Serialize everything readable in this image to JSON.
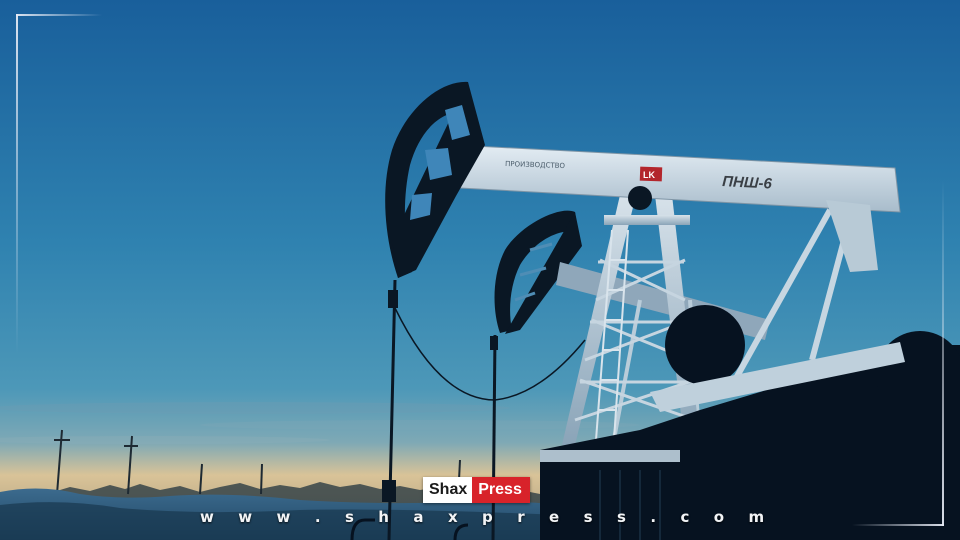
{
  "photo": {
    "sky_top_color": "#1c6aa8",
    "sky_mid_color": "#3a8fb8",
    "horizon_color": "#e8c89a",
    "silhouette_color": "#071320",
    "beam_color": "#cfdde8"
  },
  "pumpjack_main": {
    "model_label": "ПНШ-6"
  },
  "branding": {
    "logo_part_a": "Shax",
    "logo_part_b": "Press",
    "logo_red": "#d8232a",
    "website": "w w w . s h a x p r e s s . c o m"
  }
}
